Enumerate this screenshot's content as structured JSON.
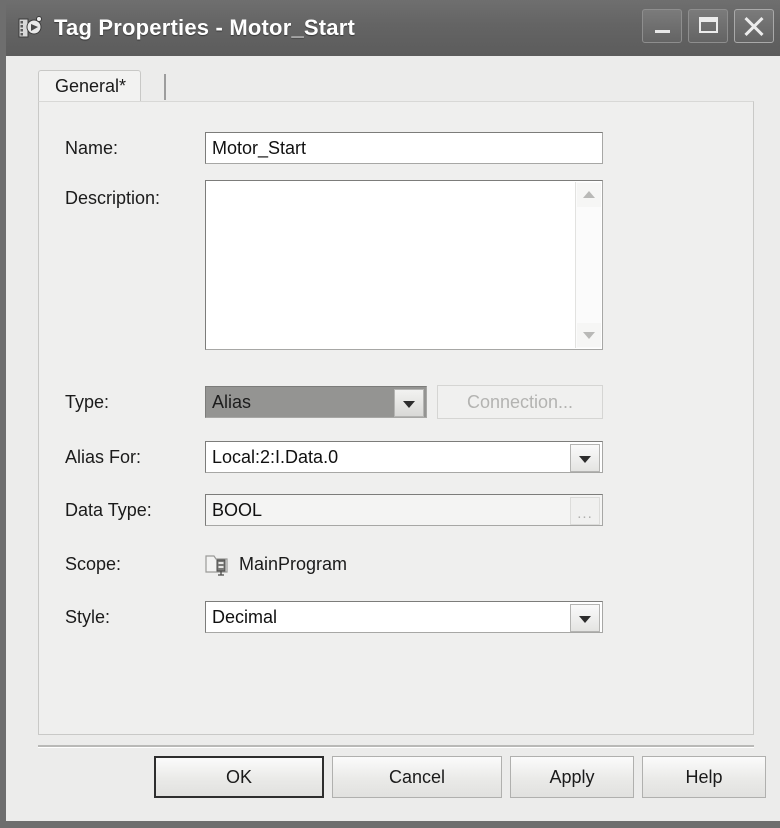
{
  "window": {
    "title": "Tag Properties - Motor_Start",
    "icon": "tag-properties-icon",
    "controls": {
      "minimize": "minimize-icon",
      "maximize": "maximize-icon",
      "close": "close-icon"
    }
  },
  "tabs": [
    {
      "label": "General*"
    }
  ],
  "form": {
    "name": {
      "label": "Name:",
      "value": "Motor_Start"
    },
    "description": {
      "label": "Description:",
      "value": "",
      "scrollbar": {
        "up": "scroll-up-icon",
        "down": "scroll-down-icon"
      }
    },
    "type": {
      "label": "Type:",
      "value": "Alias",
      "connection_button": "Connection..."
    },
    "alias_for": {
      "label": "Alias For:",
      "value": "Local:2:I.Data.0"
    },
    "data_type": {
      "label": "Data Type:",
      "value": "BOOL",
      "browse_button": "..."
    },
    "scope": {
      "label": "Scope:",
      "value": "MainProgram",
      "icon": "program-folder-icon"
    },
    "style": {
      "label": "Style:",
      "value": "Decimal"
    }
  },
  "buttons": {
    "ok": "OK",
    "cancel": "Cancel",
    "apply": "Apply",
    "help": "Help"
  },
  "colors": {
    "titlebar": "#646464",
    "dialog_bg": "#ececeb",
    "panel_bg": "#efefee",
    "field_bg": "#ffffff",
    "disabled_field_bg": "#949492",
    "disabled_text": "#b3b3b1",
    "text": "#1b1b1b"
  }
}
